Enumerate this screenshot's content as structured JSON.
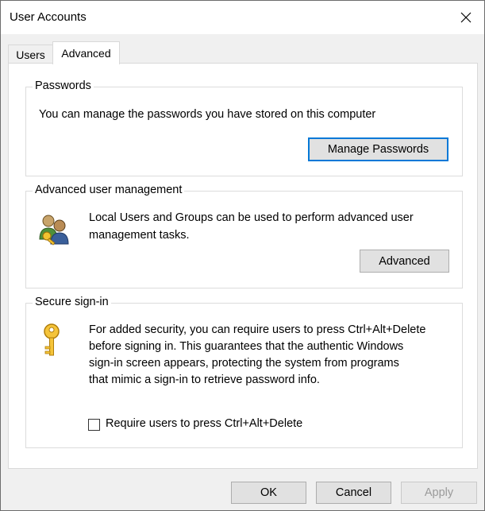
{
  "window": {
    "title": "User Accounts"
  },
  "tabs": [
    {
      "label": "Users",
      "active": false
    },
    {
      "label": "Advanced",
      "active": true
    }
  ],
  "passwords": {
    "title": "Passwords",
    "description": "You can manage the passwords you have stored on this computer",
    "button_label": "Manage Passwords"
  },
  "advanced": {
    "title": "Advanced user management",
    "description_line1": "Local Users and Groups can be used to perform advanced user",
    "description_line2": "management tasks.",
    "button_label": "Advanced",
    "icon": "users-group-icon"
  },
  "secure": {
    "title": "Secure sign-in",
    "line1": "For added security, you can require users to press Ctrl+Alt+Delete",
    "line2": "before signing in. This guarantees that the authentic Windows",
    "line3": "sign-in screen appears, protecting the system from programs",
    "line4": "that mimic a sign-in to retrieve password info.",
    "checkbox_label": "Require users to press Ctrl+Alt+Delete",
    "checkbox_checked": false,
    "icon": "key-icon"
  },
  "footer": {
    "ok_label": "OK",
    "cancel_label": "Cancel",
    "apply_label": "Apply"
  },
  "colors": {
    "accent": "#0078d7",
    "button_face": "#e1e1e1",
    "dialog_bg": "#f0f0f0"
  }
}
